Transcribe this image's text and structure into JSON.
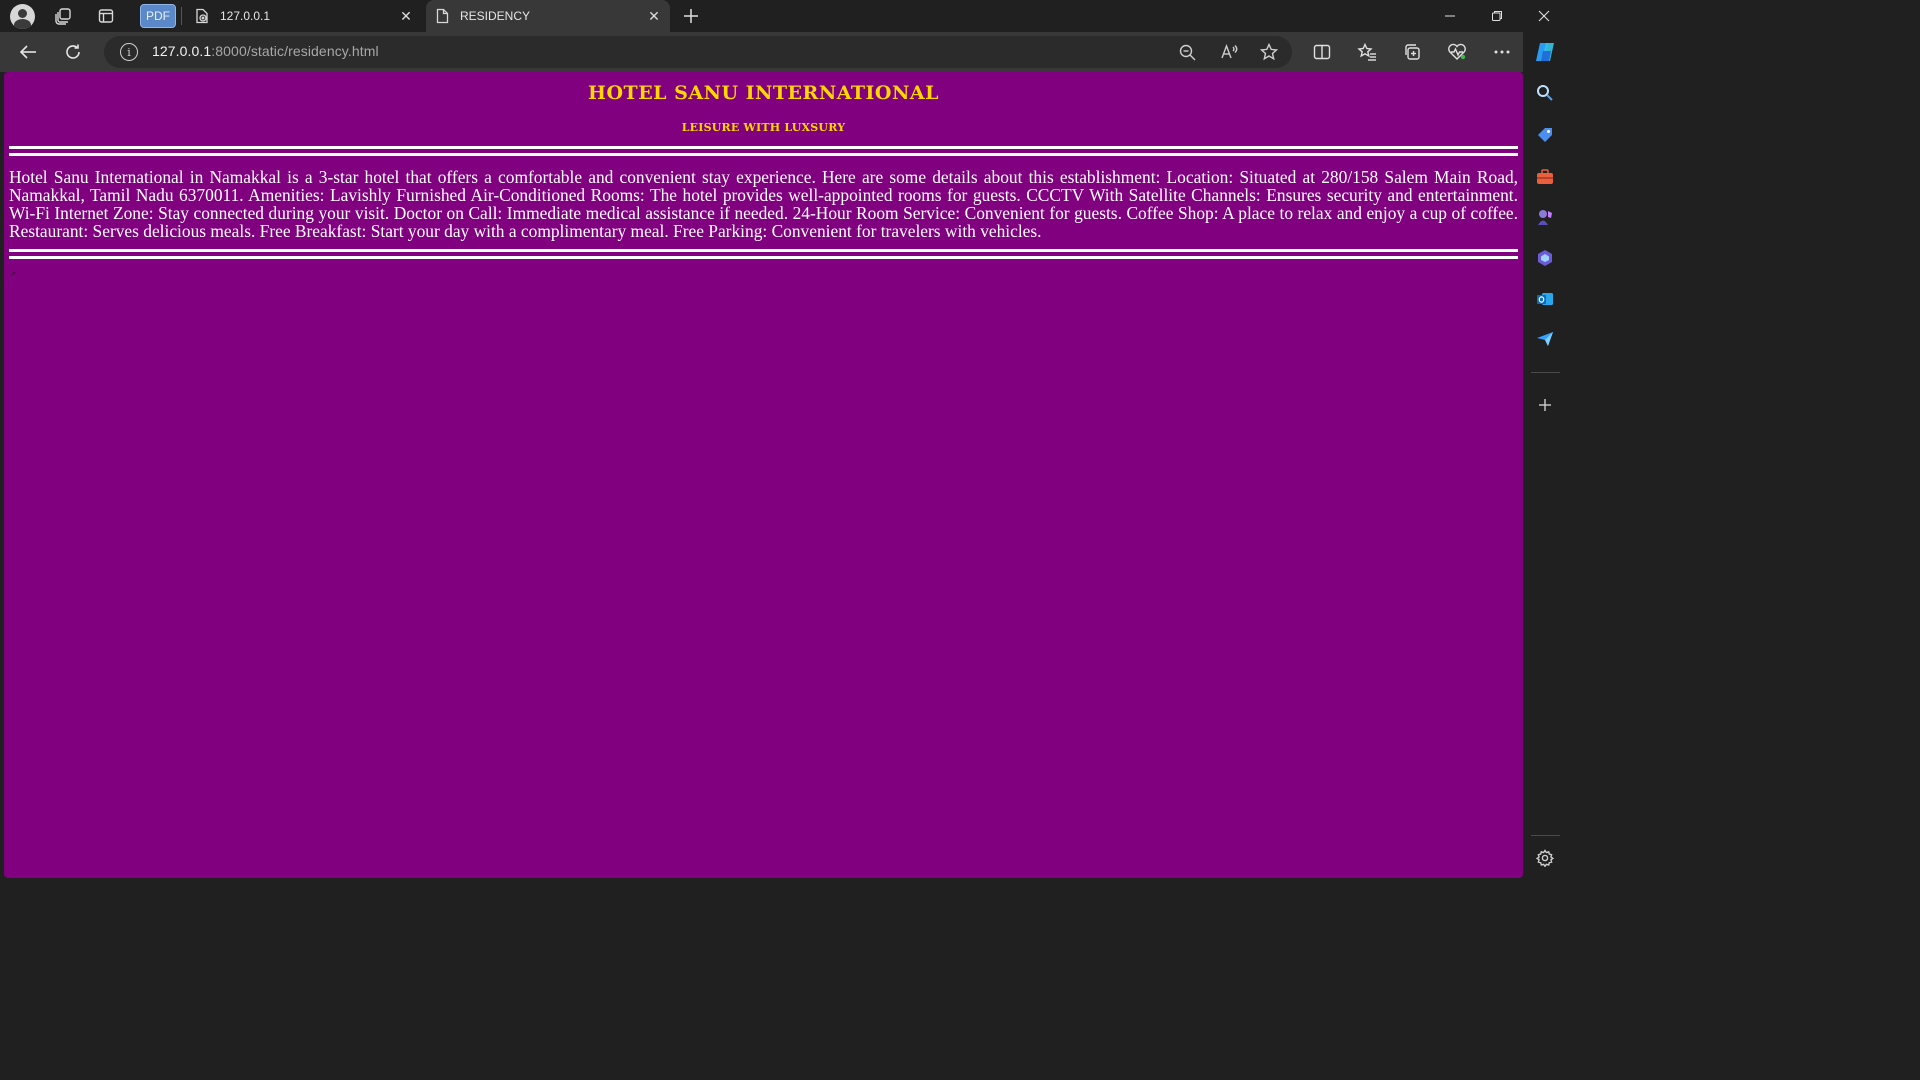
{
  "browser": {
    "pdf_label": "PDF",
    "tabs": [
      {
        "title": "127.0.0.1",
        "active": false
      },
      {
        "title": "RESIDENCY",
        "active": true
      }
    ],
    "address": {
      "host": "127.0.0.1",
      "path": ":8000/static/residency.html"
    }
  },
  "page": {
    "background": "#800080",
    "title": "HOTEL SANU INTERNATIONAL",
    "subtitle": "leisure with luxsury",
    "accent_color": "#ffd700",
    "description": "Hotel Sanu International in Namakkal is a 3-star hotel that offers a comfortable and convenient stay experience. Here are some details about this establishment: Location: Situated at 280/158 Salem Main Road, Namakkal, Tamil Nadu 6370011. Amenities: Lavishly Furnished Air-Conditioned Rooms: The hotel provides well-appointed rooms for guests. CCCTV With Satellite Channels: Ensures security and entertainment. Wi-Fi Internet Zone: Stay connected during your visit. Doctor on Call: Immediate medical assistance if needed. 24-Hour Room Service: Convenient for guests. Coffee Shop: A place to relax and enjoy a cup of coffee. Restaurant: Serves delicious meals. Free Breakfast: Start your day with a complimentary meal. Free Parking: Convenient for travelers with vehicles.",
    "stray_mark": ">"
  },
  "icons": {
    "sidebar": [
      "search-icon",
      "shopping-tag-icon",
      "toolbox-icon",
      "games-icon",
      "copilot-designer-icon",
      "outlook-icon",
      "send-icon",
      "add-icon",
      "settings-icon"
    ]
  }
}
